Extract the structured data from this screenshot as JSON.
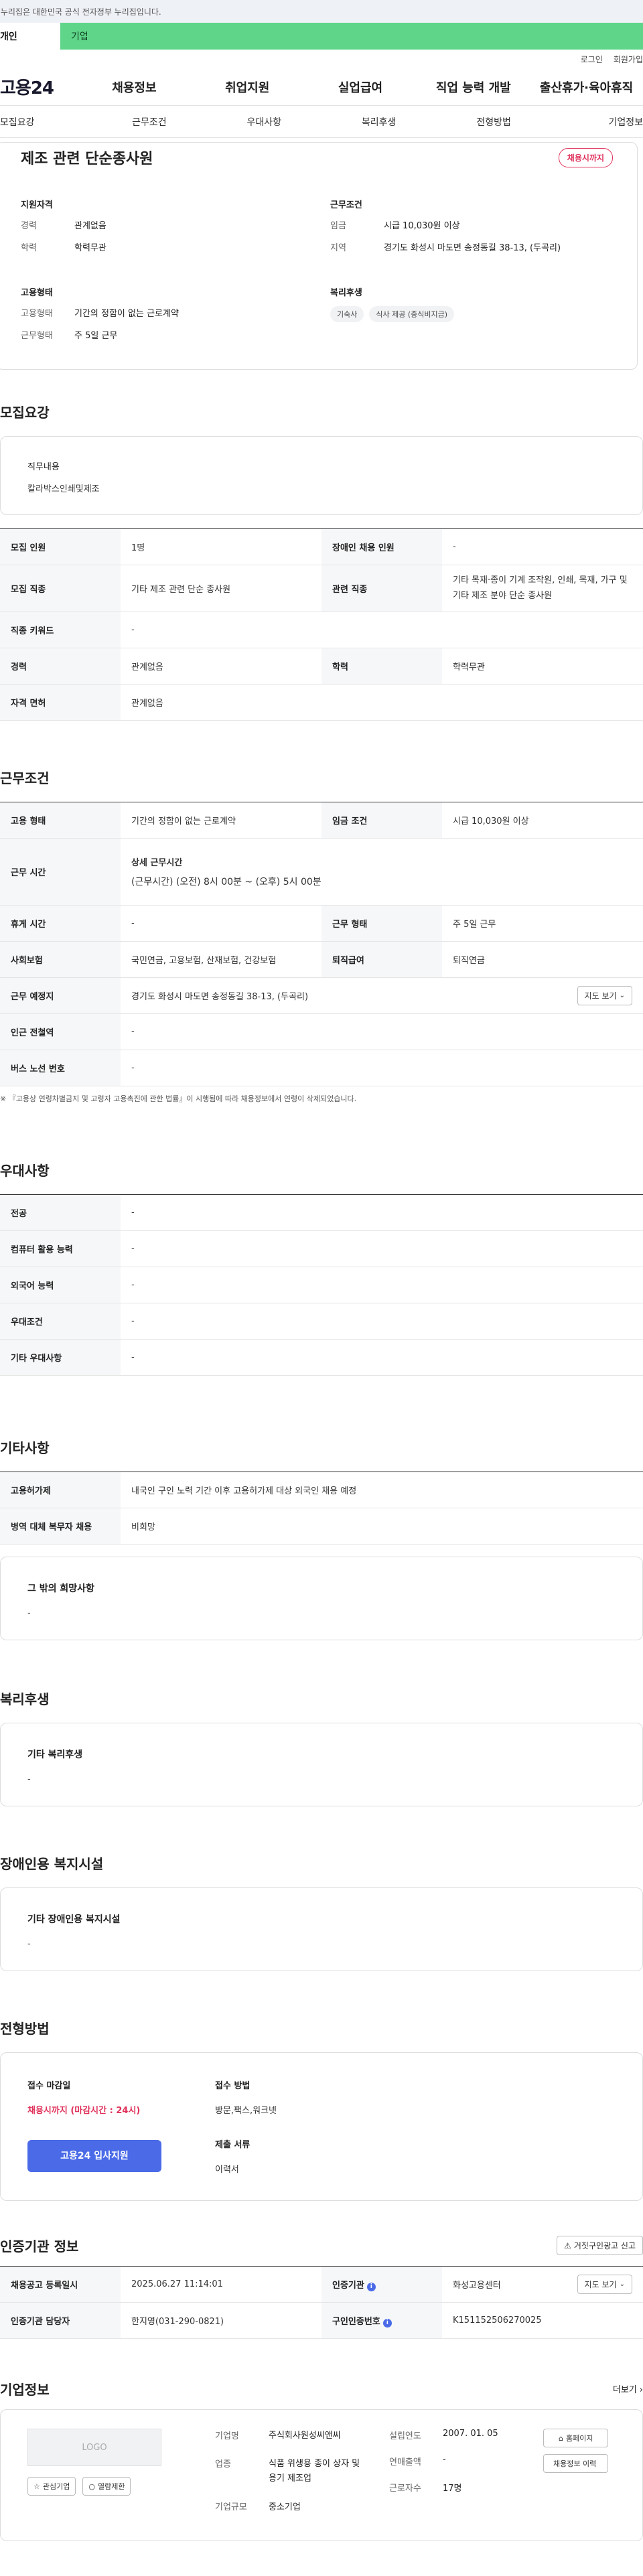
{
  "gov_banner": "이 누리집은 대한민국 공식 전자정부 누리집입니다.",
  "user_tabs": [
    "개인",
    "기업"
  ],
  "top_links": [
    "로그인",
    "회원가입"
  ],
  "logo": "고용24",
  "gnb": [
    "채용정보",
    "취업지원",
    "실업급여",
    "직업 능력 개발",
    "출산휴가·육아휴직"
  ],
  "anchor_nav": [
    "모집요강",
    "근무조건",
    "우대사항",
    "복리후생",
    "전형방법",
    "기업정보"
  ],
  "summary": {
    "title": "제조 관련 단순종사원",
    "badge": "채용시까지",
    "qual_label": "지원자격",
    "career_k": "경력",
    "career_v": "관계없음",
    "edu_k": "학력",
    "edu_v": "학력무관",
    "cond_label": "근무조건",
    "wage_k": "임금",
    "wage_v": "시급 10,030원 이상",
    "region_k": "지역",
    "region_v": "경기도 화성시 마도면 송정동길 38-13, (두곡리)",
    "emp_label": "고용형태",
    "emptype_k": "고용형태",
    "emptype_v": "기간의 정함이 없는 근로계약",
    "worktype_k": "근무형태",
    "worktype_v": "주 5일 근무",
    "welfare_label": "복리후생",
    "welfare_tags": [
      "기숙사",
      "식사 제공 (중식비지급)"
    ]
  },
  "recruit": {
    "title": "모집요강",
    "duty_label": "직무내용",
    "duty_text": "칼라박스인쇄및제조",
    "rows": {
      "count_k": "모집 인원",
      "count_v": "1명",
      "disabled_k": "장애인 채용 인원",
      "disabled_v": "-",
      "job_k": "모집 직종",
      "job_v": "기타 제조 관련 단순 종사원",
      "rel_k": "관련 직종",
      "rel_v": "기타 목재·종이 기계 조작원, 인쇄, 목재, 가구 및 기타 제조 분야 단순 종사원",
      "kw_k": "직종 키워드",
      "kw_v": "-",
      "career_k": "경력",
      "career_v": "관계없음",
      "edu_k": "학력",
      "edu_v": "학력무관",
      "lic_k": "자격 면허",
      "lic_v": "관계없음"
    }
  },
  "work": {
    "title": "근무조건",
    "emp_k": "고용 형태",
    "emp_v": "기간의 정함이 없는 근로계약",
    "wage_k": "임금 조건",
    "wage_v": "시급 10,030원 이상",
    "hours_k": "근무 시간",
    "hours_label": "상세 근무시간",
    "hours_v": "(근무시간) (오전) 8시 00분 ~ (오후) 5시 00분",
    "rest_k": "휴게 시간",
    "rest_v": "-",
    "form_k": "근무 형태",
    "form_v": "주 5일 근무",
    "ins_k": "사회보험",
    "ins_v": "국민연금, 고용보험, 산재보험, 건강보험",
    "ret_k": "퇴직급여",
    "ret_v": "퇴직연금",
    "place_k": "근무 예정지",
    "place_v": "경기도 화성시 마도면 송정동길 38-13, (두곡리)",
    "map_btn": "지도 보기",
    "subway_k": "인근 전철역",
    "subway_v": "-",
    "bus_k": "버스 노선 번호",
    "bus_v": "-",
    "note": "※ 『고용상 연령차별금지 및 고령자 고용촉진에 관한 법률』이 시행됨에 따라 채용정보에서 연령이 삭제되었습니다."
  },
  "pref": {
    "title": "우대사항",
    "rows": [
      [
        "전공",
        "-"
      ],
      [
        "컴퓨터 활용 능력",
        "-"
      ],
      [
        "외국어 능력",
        "-"
      ],
      [
        "우대조건",
        "-"
      ],
      [
        "기타 우대사항",
        "-"
      ]
    ]
  },
  "etc": {
    "title": "기타사항",
    "foreign_k": "고용허가제",
    "foreign_v": "내국인 구인 노력 기간 이후 고용허가제 대상 외국인 채용 예정",
    "mil_k": "병역 대체 복무자 채용",
    "mil_v": "비희망",
    "wish_label": "그 밖의 희망사항",
    "wish_v": "-"
  },
  "welfare": {
    "title": "복리후생",
    "label": "기타 복리후생",
    "value": "-"
  },
  "disabled": {
    "title": "장애인용 복지시설",
    "label": "기타 장애인용 복지시설",
    "value": "-"
  },
  "selection": {
    "title": "전형방법",
    "deadline_label": "접수 마감일",
    "deadline_v": "채용시까지 (마감시간 : 24시)",
    "apply_btn": "고용24 입사지원",
    "method_label": "접수 방법",
    "method_v": "방문,팩스,워크넷",
    "docs_label": "제출 서류",
    "docs_v": "이력서"
  },
  "cert": {
    "title": "인증기관 정보",
    "report_btn": "거짓구인광고 신고",
    "date_k": "채용공고 등록일시",
    "date_v": "2025.06.27 11:14:01",
    "org_k": "인증기관",
    "org_v": "화성고용센터",
    "map_btn": "지도 보기",
    "mgr_k": "인증기관 담당자",
    "mgr_v": "한지영(031-290-0821)",
    "num_k": "구인인증번호",
    "num_v": "K151152506270025"
  },
  "company": {
    "title": "기업정보",
    "more": "더보기",
    "logo": "LOGO",
    "fav_btn": "관심기업",
    "view_btn": "열람제한",
    "name_k": "기업명",
    "name_v": "주식회사원성씨앤씨",
    "ind_k": "업종",
    "ind_v": "식품 위생용 종이 상자 및 용기 제조업",
    "size_k": "기업규모",
    "size_v": "중소기업",
    "est_k": "설립연도",
    "est_v": "2007. 01. 05",
    "sales_k": "연매출액",
    "sales_v": "-",
    "emp_k": "근로자수",
    "emp_v": "17명",
    "home_btn": "홈페이지",
    "hist_btn": "채용정보 이력"
  }
}
